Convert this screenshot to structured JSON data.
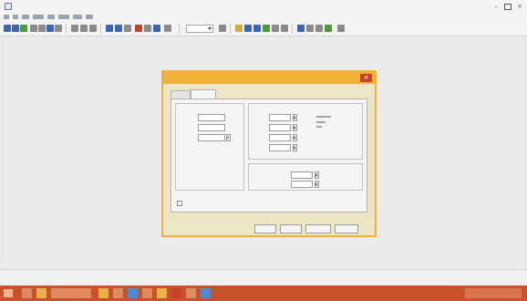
{
  "window": {
    "title": "",
    "tabs": [
      "",
      ""
    ]
  },
  "menu": {
    "items": [
      "",
      "",
      "",
      "",
      "",
      "",
      "",
      ""
    ]
  },
  "toolbar": {
    "zoom_value": "",
    "colors": {
      "blue": "#3a67b5",
      "green": "#4e9a3a",
      "red": "#c8412a",
      "gray": "#8a8a8a",
      "yellow": "#d9a73a"
    }
  },
  "dialog": {
    "title": "",
    "tabs": [
      "",
      ""
    ],
    "active_tab": 1,
    "size_group": {
      "title": "",
      "width_label": "",
      "width_value": "",
      "height_label": "",
      "height_value": "",
      "units_label": "",
      "units_value": "",
      "name_label": "",
      "name_value": "",
      "weight_label": "",
      "weight_value": ""
    },
    "dimension_group": {
      "title": "",
      "rows": [
        {
          "label": "",
          "value": "",
          "unit": ""
        },
        {
          "label": "",
          "value": "",
          "unit": ""
        },
        {
          "label": "",
          "value": "",
          "unit": ""
        },
        {
          "label": "",
          "value": "",
          "unit": ""
        }
      ]
    },
    "spacing_group": {
      "title": "",
      "row1_label": "",
      "row1_value": "",
      "row1_unit": "",
      "row2_label": "",
      "row2_value": ""
    },
    "checkbox_label": "",
    "buttons": {
      "help": "",
      "ok": "",
      "cancel": "",
      "apply": ""
    }
  },
  "status": {
    "text": ""
  },
  "accent": {
    "dialog_border": "#f0b238",
    "taskbar": "#c9522a",
    "close_button": "#c8412a"
  }
}
